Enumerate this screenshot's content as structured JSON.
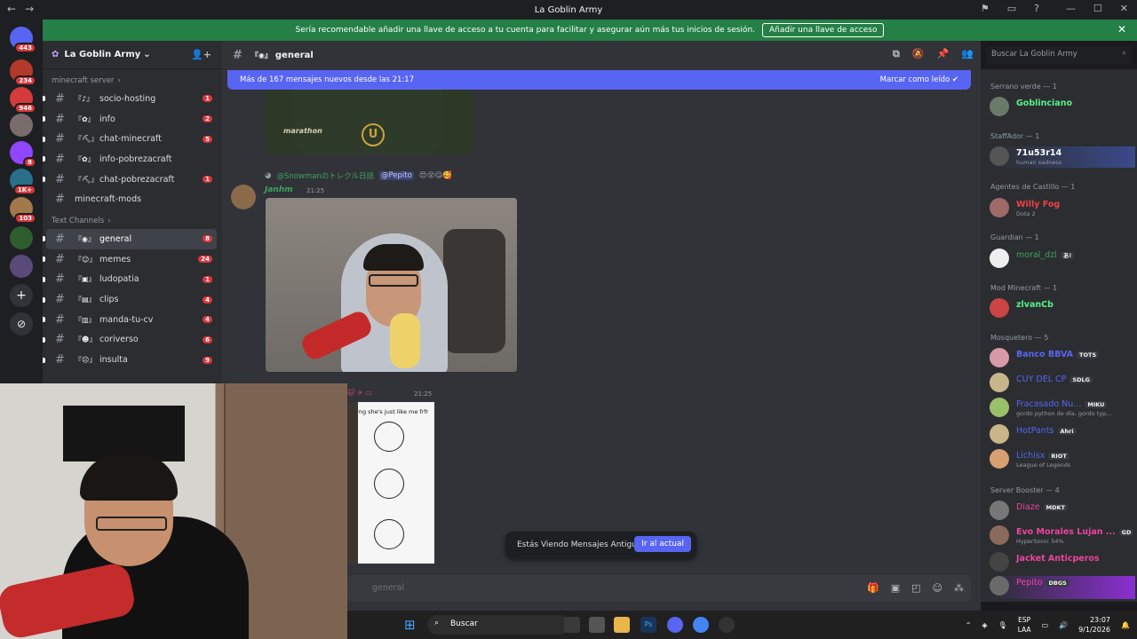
{
  "window": {
    "title": "La Goblin Army"
  },
  "banner": {
    "text": "Sería recomendable añadir una llave de acceso a tu cuenta para facilitar y asegurar aún más tus inicios de sesión.",
    "button": "Añadir una llave de acceso"
  },
  "guilds": [
    {
      "badge": "443"
    },
    {
      "badge": "234"
    },
    {
      "badge": "946"
    },
    {
      "badge": "8"
    },
    {
      "badge": "1K+"
    },
    {
      "badge": "103"
    },
    {
      "badge": ""
    },
    {
      "badge": ""
    }
  ],
  "server": {
    "name": "La Goblin Army"
  },
  "categories": [
    {
      "name": "minecraft server",
      "channels": [
        {
          "deco": "『♪』",
          "name": "socio-hosting",
          "unread": "1"
        },
        {
          "deco": "『✿』",
          "name": "info",
          "unread": "2"
        },
        {
          "deco": "『⛏』",
          "name": "chat-minecraft",
          "unread": "5"
        },
        {
          "deco": "『✿』",
          "name": "info-pobrezacraft",
          "unread": ""
        },
        {
          "deco": "『⛏』",
          "name": "chat-pobrezacraft",
          "unread": "1"
        },
        {
          "deco": "",
          "name": "minecraft-mods",
          "unread": ""
        }
      ]
    },
    {
      "name": "Text Channels",
      "channels": [
        {
          "deco": "『◉』",
          "name": "general",
          "unread": "8"
        },
        {
          "deco": "『☺』",
          "name": "memes",
          "unread": "24"
        },
        {
          "deco": "『▣』",
          "name": "ludopatia",
          "unread": "1"
        },
        {
          "deco": "『▤』",
          "name": "clips",
          "unread": "4"
        },
        {
          "deco": "『▥』",
          "name": "manda-tu-cv",
          "unread": "4"
        },
        {
          "deco": "『☻』",
          "name": "coriverso",
          "unread": "6"
        },
        {
          "deco": "『☹』",
          "name": "insulta",
          "unread": "9"
        }
      ]
    }
  ],
  "chat": {
    "channel_deco": "『◉』",
    "channel": "general",
    "new_messages": "Más de 167 mensajes nuevos desde las 21:17",
    "mark_read": "Marcar como leído",
    "reply_user": "@Snowmanのトレクル日誌",
    "reply_mention": "@Pepito",
    "reply_emojis": "😍😵😋🥰",
    "author": "Janhm",
    "time": "21:25",
    "msg2_time": "21:25",
    "meme_caption": "omg she's just like me frfr",
    "image1_text": "marathon",
    "old_messages": "Estás Viendo Mensajes Antiguos",
    "jump": "Ir al actual",
    "input_placeholder": "general"
  },
  "search": {
    "placeholder": "Buscar La Goblin Army"
  },
  "members": [
    {
      "role": "Serrano verde — 1",
      "list": [
        {
          "name": "Goblinciano",
          "status": "",
          "tag": "",
          "color": "#57f287"
        }
      ]
    },
    {
      "role": "StaffAdor — 1",
      "list": [
        {
          "name": "71u53r14",
          "status": "human sadness",
          "tag": "",
          "color": "#ffffff"
        }
      ]
    },
    {
      "role": "Agentes de Castillo — 1",
      "list": [
        {
          "name": "Willy Fog",
          "status": "Dota 2",
          "tag": "",
          "color": "#ed4245"
        }
      ]
    },
    {
      "role": "Guardian — 1",
      "list": [
        {
          "name": "moral_dzl",
          "status": "",
          "tag": "あ!",
          "color": "#3ba55c"
        }
      ]
    },
    {
      "role": "Mod Minecraft — 1",
      "list": [
        {
          "name": "zlvanCb",
          "status": "",
          "tag": "",
          "color": "#57f287"
        }
      ]
    },
    {
      "role": "Mosquetero — 5",
      "list": [
        {
          "name": "Banco BBVA",
          "status": "",
          "tag": "TOTS",
          "color": "#5865f2"
        },
        {
          "name": "CUY DEL CP",
          "status": "",
          "tag": "SDLG",
          "color": "#5865f2"
        },
        {
          "name": "Fracasado Nu...",
          "status": "gordo python de día, gordo typ...",
          "tag": "MIKU",
          "color": "#5865f2"
        },
        {
          "name": "HotPants",
          "status": "",
          "tag": "Ahri",
          "color": "#5865f2"
        },
        {
          "name": "Lichisx",
          "status": "League of Legends",
          "tag": "RIOT",
          "color": "#5865f2"
        }
      ]
    },
    {
      "role": "Server Booster — 4",
      "list": [
        {
          "name": "Diaze",
          "status": "",
          "tag": "MDKT",
          "color": "#eb459e"
        },
        {
          "name": "Evo Morales Lujan ...",
          "status": "HyperSonic 54%",
          "tag": "GD",
          "color": "#eb459e"
        },
        {
          "name": "Jacket Anticperos",
          "status": "",
          "tag": "",
          "color": "#eb459e"
        },
        {
          "name": "Pepito",
          "status": "",
          "tag": "DBGS",
          "color": "#eb459e"
        }
      ]
    }
  ],
  "taskbar": {
    "search": "Buscar",
    "lang1": "ESP",
    "lang2": "LAA",
    "time": "23:07",
    "date": "9/1/2026"
  }
}
